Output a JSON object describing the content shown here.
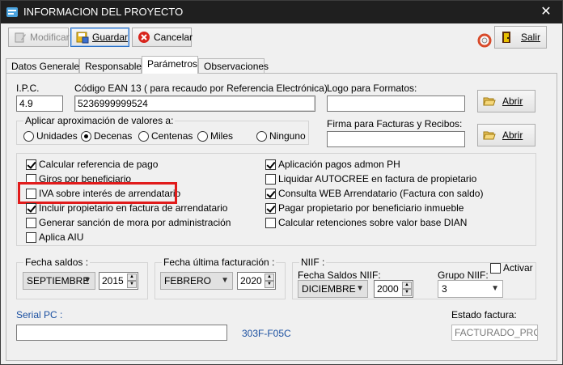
{
  "window": {
    "title": "INFORMACION DEL PROYECTO",
    "close": "✕"
  },
  "toolbar": {
    "modificar": "Modificar",
    "guardar": "Guardar",
    "cancelar": "Cancelar",
    "salir": "Salir"
  },
  "tabs": [
    "Datos Generales",
    "Responsables",
    "Parámetros",
    "Observaciones"
  ],
  "params": {
    "ipc_label": "I.P.C.",
    "ipc_value": "4.9",
    "ean_label": "Código EAN 13 ( para recaudo por Referencia Electrónica)",
    "ean_value": "5236999999524",
    "logo_label": "Logo para Formatos:",
    "logo_value": "",
    "abrir1": "Abrir",
    "firma_label": "Firma para Facturas y Recibos:",
    "firma_value": "",
    "abrir2": "Abrir",
    "aprox_label": "Aplicar aproximación de valores a:",
    "radios": [
      "Unidades",
      "Decenas",
      "Centenas",
      "Miles",
      "Ninguno"
    ],
    "radio_selected": "Decenas"
  },
  "checks_left": [
    {
      "label": "Calcular referencia de pago",
      "checked": true
    },
    {
      "label": "Giros por beneficiario",
      "checked": false
    },
    {
      "label": "IVA sobre interés de arrendatario",
      "checked": false
    },
    {
      "label": "Incluir propietario en factura de arrendatario",
      "checked": true
    },
    {
      "label": "Generar sanción de mora por administración",
      "checked": false
    },
    {
      "label": "Aplica AIU",
      "checked": false
    }
  ],
  "checks_right": [
    {
      "label": "Aplicación pagos admon PH",
      "checked": true
    },
    {
      "label": "Liquidar AUTOCREE en factura de propietario",
      "checked": false
    },
    {
      "label": "Consulta WEB Arrendatario (Factura con saldo)",
      "checked": true
    },
    {
      "label": "Pagar propietario por beneficiario inmueble",
      "checked": true
    },
    {
      "label": "Calcular retenciones sobre valor base DIAN",
      "checked": false
    }
  ],
  "fechas": {
    "saldos_title": "Fecha saldos :",
    "saldos_mes": "SEPTIEMBRE",
    "saldos_anio": "2015",
    "ultima_title": "Fecha última facturación :",
    "ultima_mes": "FEBRERO",
    "ultima_anio": "2020",
    "niif_title": "NIIF :",
    "niif_saldos_label": "Fecha Saldos NIIF:",
    "niif_mes": "DICIEMBRE",
    "niif_anio": "2000",
    "grupo_label": "Grupo NIIF:",
    "grupo_value": "3",
    "activar": "Activar"
  },
  "footer": {
    "serial_label": "Serial PC :",
    "serial_value": "",
    "serial_code": "303F-F05C",
    "estado_label": "Estado factura:",
    "estado_value": "FACTURADO_PROP"
  },
  "colors": {
    "highlight": "#e11b1b",
    "accent": "#1a4fa0"
  }
}
